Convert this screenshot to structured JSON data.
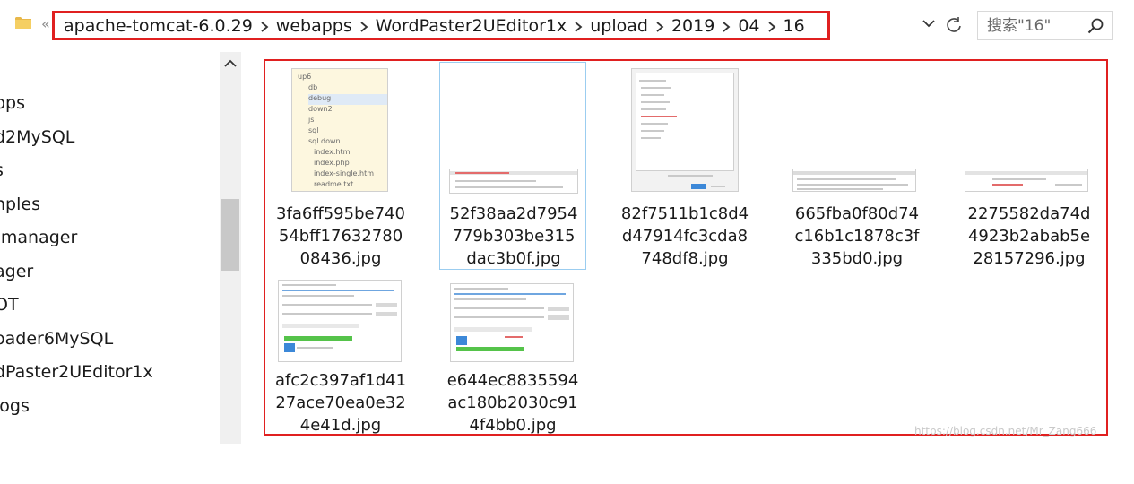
{
  "address_bar": {
    "overflow": "«",
    "breadcrumbs": [
      "apache-tomcat-6.0.29",
      "webapps",
      "WordPaster2UEditor1x",
      "upload",
      "2019",
      "04",
      "16"
    ],
    "search_placeholder": "搜索\"16\""
  },
  "nav": {
    "items": [
      "pps",
      "d2MySQL",
      "s",
      "nples",
      "-manager",
      "ager",
      "OT",
      "oader6MySQL",
      "dPaster2UEditor1x",
      "logs"
    ]
  },
  "files": [
    {
      "name": "3fa6ff595be74054bff1763278008436.jpg",
      "lines": [
        "3fa6ff595be740",
        "54bff17632780",
        "08436.jpg"
      ],
      "selected": false
    },
    {
      "name": "52f38aa2d7954779b303be315dac3b0f.jpg",
      "lines": [
        "52f38aa2d7954",
        "779b303be315",
        "dac3b0f.jpg"
      ],
      "selected": true
    },
    {
      "name": "82f7511b1c8d4d47914fc3cda8748df8.jpg",
      "lines": [
        "82f7511b1c8d4",
        "d47914fc3cda8",
        "748df8.jpg"
      ],
      "selected": false
    },
    {
      "name": "665fba0f80d74c16b1c1878c3f335bd0.jpg",
      "lines": [
        "665fba0f80d74",
        "c16b1c1878c3f",
        "335bd0.jpg"
      ],
      "selected": false
    },
    {
      "name": "2275582da74d4923b2abab5e28157296.jpg",
      "lines": [
        "2275582da74d",
        "4923b2abab5e",
        "28157296.jpg"
      ],
      "selected": false
    },
    {
      "name": "afc2c397af1d4127ace70ea0e324e41d.jpg",
      "lines": [
        "afc2c397af1d41",
        "27ace70ea0e32",
        "4e41d.jpg"
      ],
      "selected": false
    },
    {
      "name": "e644ec8835594ac180b2030c914f4bb0.jpg",
      "lines": [
        "e644ec8835594",
        "ac180b2030c91",
        "4f4bb0.jpg"
      ],
      "selected": false
    }
  ],
  "thumb_tree": [
    "up6",
    "db",
    "debug",
    "down2",
    "js",
    "sql",
    "sql.down",
    "index.htm",
    "index.php",
    "index-single.htm",
    "readme.txt"
  ],
  "watermark": "https://blog.csdn.net/Mr_Zang666",
  "colors": {
    "highlight_border": "#e02020",
    "selection_border": "#9bcdf0",
    "accent": "#3c88d8"
  }
}
